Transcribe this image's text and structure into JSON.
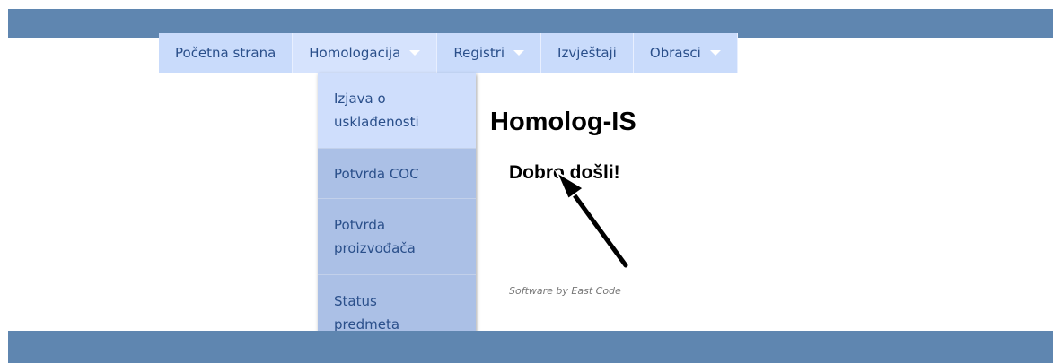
{
  "nav": {
    "items": [
      {
        "label": "Početna strana",
        "has_caret": false
      },
      {
        "label": "Homologacija",
        "has_caret": true
      },
      {
        "label": "Registri",
        "has_caret": true
      },
      {
        "label": "Izvještaji",
        "has_caret": false
      },
      {
        "label": "Obrasci",
        "has_caret": true
      }
    ],
    "dropdown": [
      {
        "label": "Izjava o usklađenosti"
      },
      {
        "label": "Potvrda COC"
      },
      {
        "label": "Potvrda proizvođača"
      },
      {
        "label": "Status predmeta"
      }
    ]
  },
  "main": {
    "title": "Homolog-IS",
    "welcome": "Dobro došli!",
    "credit": "Software by East Code"
  },
  "colors": {
    "bar": "#5f86b0",
    "nav_bg": "#c9dbfb",
    "nav_text": "#2a4f8a",
    "dropdown_hover": "#cfdefc",
    "dropdown_item": "#abc0e6"
  }
}
